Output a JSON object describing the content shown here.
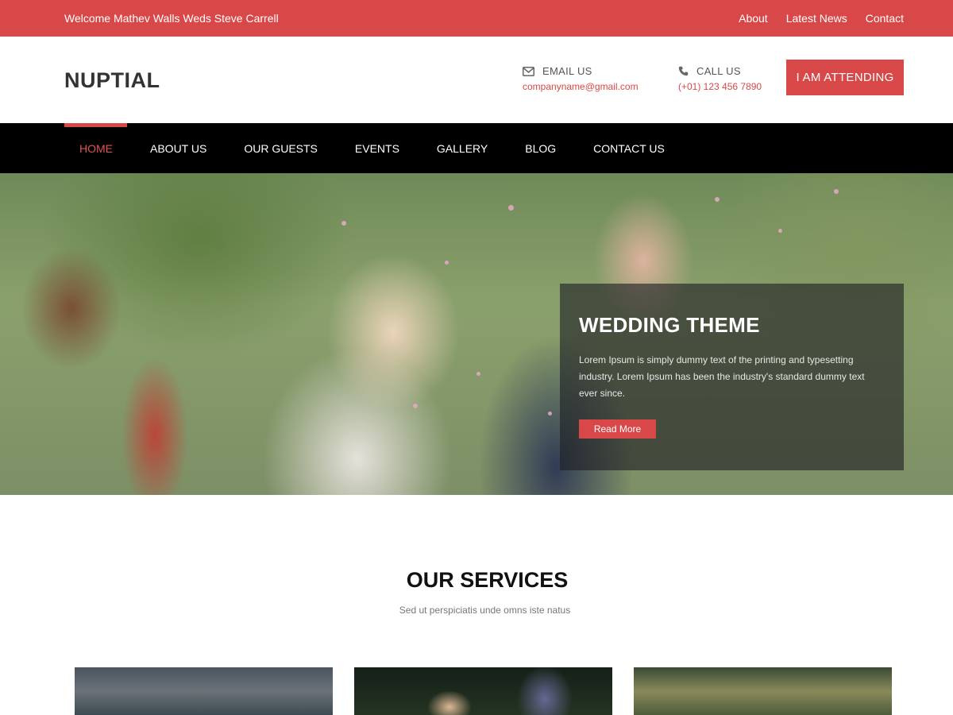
{
  "topbar": {
    "welcome": "Welcome Mathev Walls Weds Steve Carrell",
    "links": [
      "About",
      "Latest News",
      "Contact"
    ]
  },
  "header": {
    "logo": "NUPTIAL",
    "email": {
      "label": "EMAIL US",
      "value": "companyname@gmail.com",
      "icon": "envelope-icon"
    },
    "call": {
      "label": "CALL US",
      "value": "(+01) 123 456 7890",
      "icon": "phone-icon"
    },
    "attend_button": "I AM ATTENDING"
  },
  "nav": {
    "items": [
      "HOME",
      "ABOUT US",
      "OUR GUESTS",
      "EVENTS",
      "GALLERY",
      "BLOG",
      "CONTACT US"
    ],
    "active": "HOME"
  },
  "hero": {
    "title": "WEDDING THEME",
    "text": "Lorem Ipsum is simply dummy text of the printing and typesetting industry. Lorem Ipsum has been the industry's standard dummy text ever since.",
    "button": "Read More"
  },
  "services": {
    "title": "OUR SERVICES",
    "subtitle": "Sed ut perspiciatis unde omns iste natus"
  },
  "colors": {
    "accent": "#d94848",
    "nav_bg": "#000000"
  }
}
